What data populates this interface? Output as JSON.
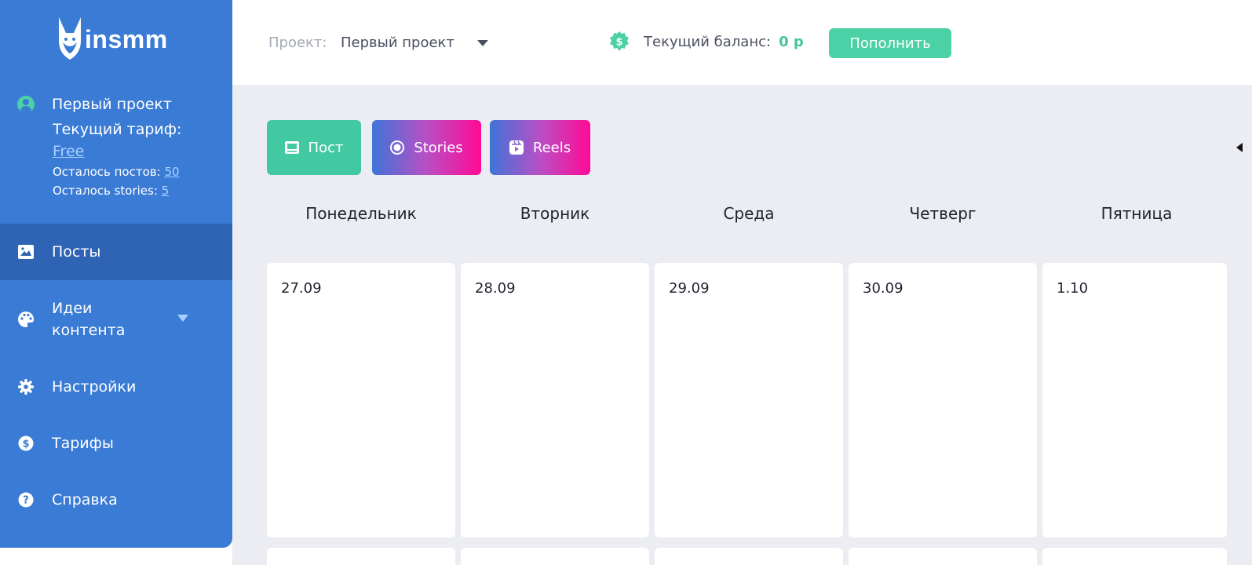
{
  "brand": {
    "name": "insmm"
  },
  "sidebar": {
    "project_name": "Первый проект",
    "tariff_label": "Текущий тариф:",
    "tariff_value": "Free",
    "posts_left_label": "Осталось постов:",
    "posts_left_value": "50",
    "stories_left_label": "Осталось stories:",
    "stories_left_value": "5",
    "items": [
      {
        "label": "Посты",
        "icon": "image-icon"
      },
      {
        "label": "Идеи\nконтента",
        "icon": "palette-icon"
      },
      {
        "label": "Настройки",
        "icon": "gear-icon"
      },
      {
        "label": "Тарифы",
        "icon": "dollar-icon"
      },
      {
        "label": "Справка",
        "icon": "question-icon"
      }
    ],
    "active_index": 0
  },
  "header": {
    "project_label": "Проект:",
    "project_value": "Первый проект",
    "balance_label": "Текущий баланс:",
    "balance_value": "0 р",
    "topup_label": "Пополнить"
  },
  "toolbar": {
    "post_label": "Пост",
    "stories_label": "Stories",
    "reels_label": "Reels"
  },
  "calendar": {
    "days": [
      {
        "name": "Понедельник",
        "date": "27.09"
      },
      {
        "name": "Вторник",
        "date": "28.09"
      },
      {
        "name": "Среда",
        "date": "29.09"
      },
      {
        "name": "Четверг",
        "date": "30.09"
      },
      {
        "name": "Пятница",
        "date": "1.10"
      }
    ]
  },
  "colors": {
    "sidebar": "#3a7bd5",
    "sidebar_active": "#2f63b4",
    "accent_green": "#4cd0a5",
    "gradient_start": "#3f74d8",
    "gradient_end": "#ff0a95",
    "background": "#ecedf2"
  }
}
